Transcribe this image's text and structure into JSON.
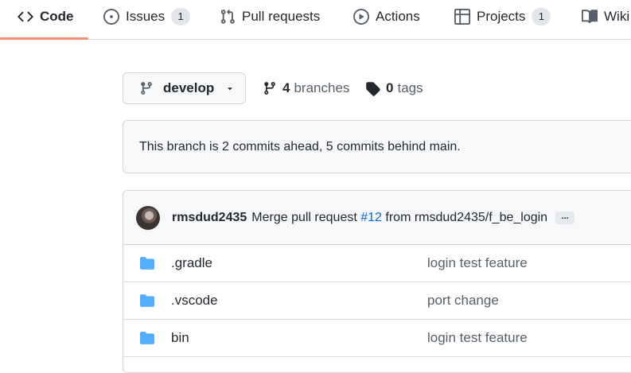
{
  "nav": {
    "tabs": [
      {
        "label": "Code",
        "icon": "code-icon",
        "selected": true
      },
      {
        "label": "Issues",
        "icon": "issue-opened-icon",
        "count": "1"
      },
      {
        "label": "Pull requests",
        "icon": "git-pull-request-icon"
      },
      {
        "label": "Actions",
        "icon": "play-icon"
      },
      {
        "label": "Projects",
        "icon": "table-icon",
        "count": "1"
      },
      {
        "label": "Wiki",
        "icon": "book-icon"
      }
    ]
  },
  "branch": {
    "current": "develop",
    "branches_count": "4",
    "branches_label": "branches",
    "tags_count": "0",
    "tags_label": "tags"
  },
  "flash": {
    "text": "This branch is 2 commits ahead, 5 commits behind main."
  },
  "commit": {
    "author": "rmsdud2435",
    "message_prefix": "Merge pull request",
    "pr_number": "#12",
    "message_suffix": "from rmsdud2435/f_be_login",
    "ellipsis": "..."
  },
  "files": [
    {
      "name": ".gradle",
      "type": "directory",
      "message": "login test feature"
    },
    {
      "name": ".vscode",
      "type": "directory",
      "message": "port change"
    },
    {
      "name": "bin",
      "type": "directory",
      "message": "login test feature"
    }
  ],
  "colors": {
    "accent_underline": "#fd8c73",
    "link": "#0969da",
    "folder": "#54aeff"
  }
}
